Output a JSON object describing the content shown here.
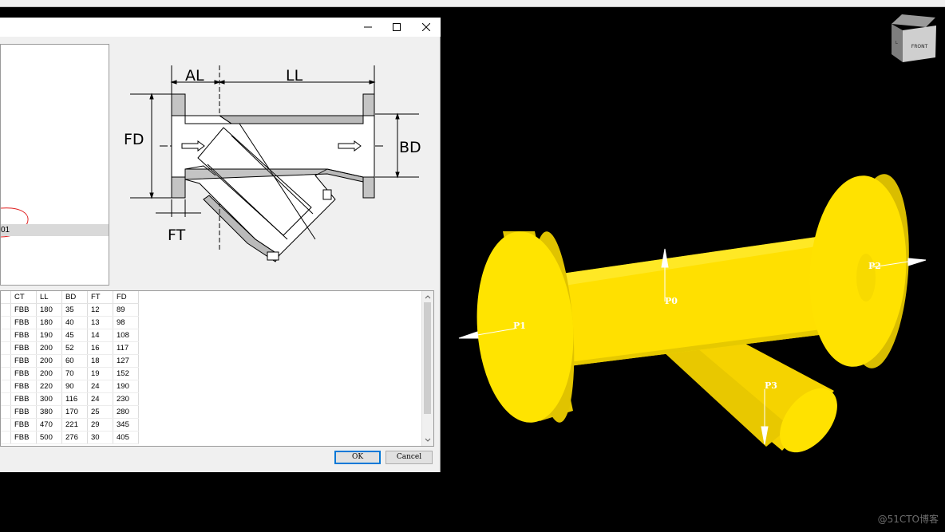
{
  "dialog": {
    "window_buttons": {
      "minimize": "—",
      "maximize": "☐",
      "close": "✕"
    },
    "tree": {
      "selected_item": "01"
    },
    "diagram_labels": {
      "al": "AL",
      "ll": "LL",
      "fd": "FD",
      "bd": "BD",
      "ft": "FT"
    },
    "table": {
      "columns": [
        "",
        "CT",
        "LL",
        "BD",
        "FT",
        "FD"
      ],
      "rows": [
        [
          "",
          "FBB",
          "180",
          "35",
          "12",
          "89"
        ],
        [
          "",
          "FBB",
          "180",
          "40",
          "13",
          "98"
        ],
        [
          "",
          "FBB",
          "190",
          "45",
          "14",
          "108"
        ],
        [
          "",
          "FBB",
          "200",
          "52",
          "16",
          "117"
        ],
        [
          "",
          "FBB",
          "200",
          "60",
          "18",
          "127"
        ],
        [
          "",
          "FBB",
          "200",
          "70",
          "19",
          "152"
        ],
        [
          "",
          "FBB",
          "220",
          "90",
          "24",
          "190"
        ],
        [
          "",
          "FBB",
          "300",
          "116",
          "24",
          "230"
        ],
        [
          "",
          "FBB",
          "380",
          "170",
          "25",
          "280"
        ],
        [
          "",
          "FBB",
          "470",
          "221",
          "29",
          "345"
        ],
        [
          "",
          "FBB",
          "500",
          "276",
          "30",
          "405"
        ]
      ]
    },
    "buttons": {
      "ok": "OK",
      "cancel": "Cancel"
    }
  },
  "viewport": {
    "nav_cube": {
      "front_label": "FRONT",
      "side_label": "L"
    },
    "ports": {
      "p0": "P0",
      "p1": "P1",
      "p2": "P2",
      "p3": "P3"
    },
    "model_color": "#ffe000"
  },
  "watermark": "@51CTO博客"
}
